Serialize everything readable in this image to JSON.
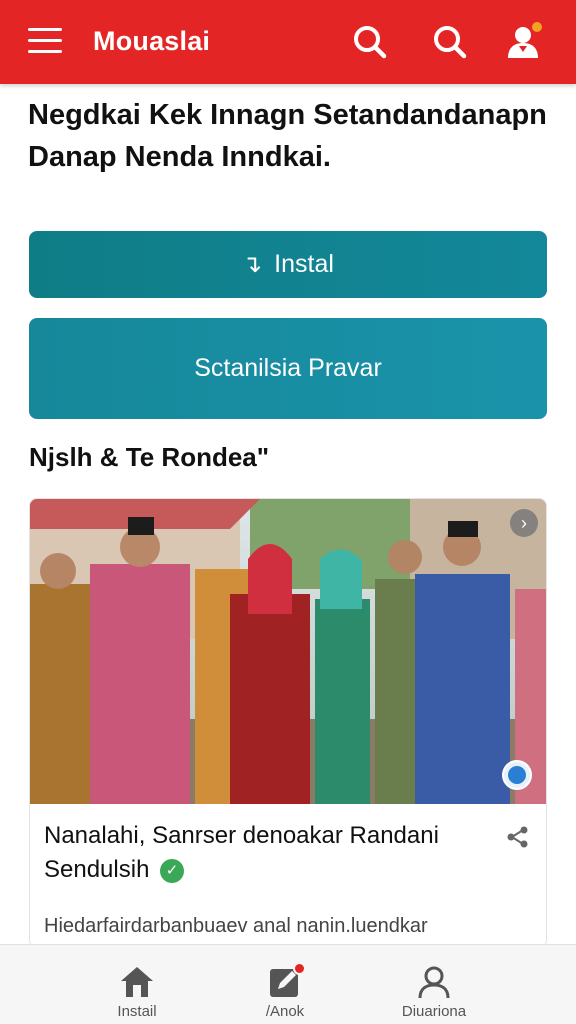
{
  "header": {
    "app_title": "Mouaslai",
    "menu_icon": "hamburger-menu-icon",
    "search_icon": "search-icon",
    "profile_icon": "user-icon",
    "brand_color": "#e42525"
  },
  "main": {
    "heading": "Negdkai Kek Innagn Setandandanapn Danap Nenda Inndkai.",
    "install_button": {
      "icon": "↴",
      "label": "Instal"
    },
    "secondary_button": {
      "label": "Sctanilsia Pravar"
    },
    "section_title": "Njslh & Te Rondea\""
  },
  "card": {
    "title": "Nanalahi, Sanrser denoakar Randani Sendulsih",
    "subtitle": "Hiedarfairdarbanbuaev anal nanin.luendkar",
    "verified_icon": "checkmark-badge-icon",
    "share_icon": "share-icon",
    "next_icon": "chevron-right-icon"
  },
  "bottom_nav": {
    "items": [
      {
        "label": "Instail",
        "icon": "home-icon"
      },
      {
        "label": "/Anok",
        "icon": "edit-icon"
      },
      {
        "label": "Diuariona",
        "icon": "user-icon"
      }
    ]
  }
}
